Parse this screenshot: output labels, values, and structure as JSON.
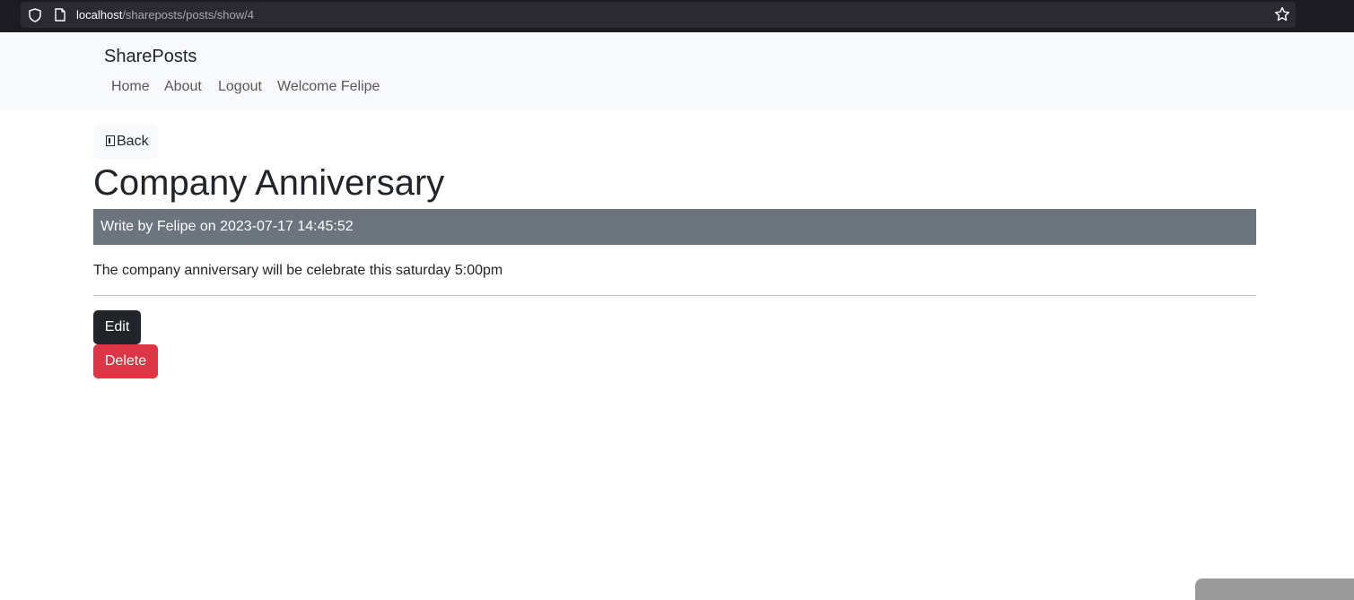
{
  "browser": {
    "url_host": "localhost",
    "url_path": "/shareposts/posts/show/4",
    "icons": [
      "shield-icon",
      "page-icon",
      "star-icon"
    ]
  },
  "navbar": {
    "brand": "SharePosts",
    "links": [
      {
        "label": "Home"
      },
      {
        "label": "About"
      },
      {
        "label": "Logout"
      },
      {
        "label": "Welcome Felipe"
      }
    ]
  },
  "post": {
    "back_label": "Back",
    "title": "Company Anniversary",
    "meta": "Write by Felipe on 2023-07-17 14:45:52",
    "body": "The company anniversary will be celebrate this saturday 5:00pm",
    "edit_label": "Edit",
    "delete_label": "Delete"
  },
  "colors": {
    "navbar_bg": "#f8f9fa",
    "meta_bg": "#6c757d",
    "edit_bg": "#212529",
    "delete_bg": "#dc3545"
  }
}
